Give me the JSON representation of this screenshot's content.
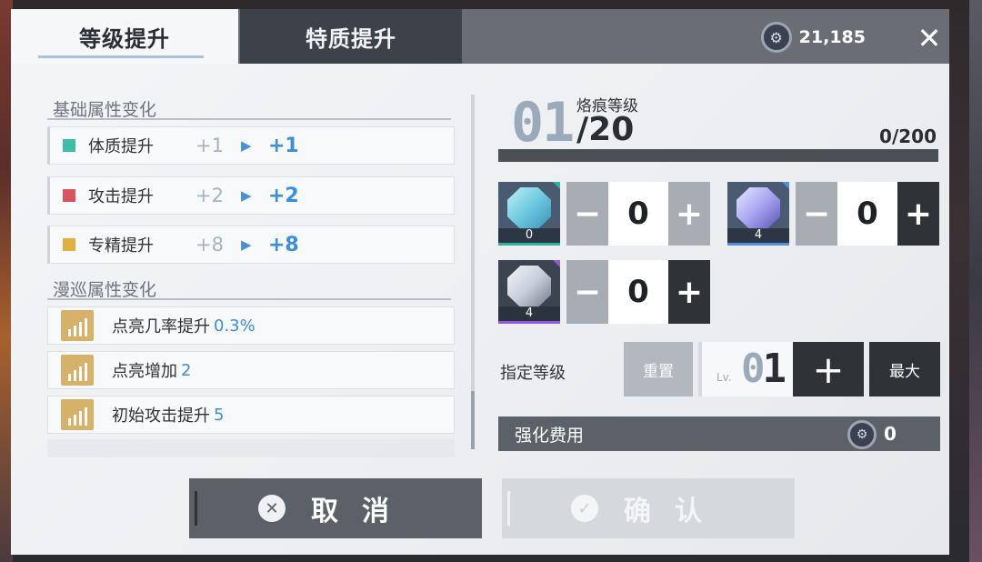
{
  "tabs": {
    "level_up": "等级提升",
    "trait_up": "特质提升"
  },
  "currency": {
    "amount": "21,185",
    "icon": "gear-coin-icon"
  },
  "basic": {
    "title": "基础属性变化",
    "rows": [
      {
        "label": "体质提升",
        "old": "+1",
        "new": "+1",
        "color": "#3dbca6"
      },
      {
        "label": "攻击提升",
        "old": "+2",
        "new": "+2",
        "color": "#d9545c"
      },
      {
        "label": "专精提升",
        "old": "+8",
        "new": "+8",
        "color": "#e0b142"
      }
    ]
  },
  "patrol": {
    "title": "漫巡属性变化",
    "rows": [
      {
        "label": "点亮几率提升",
        "value": "0.3%"
      },
      {
        "label": "点亮增加",
        "value": "2"
      },
      {
        "label": "初始攻击提升",
        "value": "5"
      }
    ]
  },
  "level": {
    "current": "01",
    "name": "烙痕等级",
    "max": "/20",
    "progress": "0/200",
    "progress_fraction": 0
  },
  "materials": [
    {
      "count": "0",
      "qty": "0",
      "rarity_color": "#2fb39a",
      "crystal": "#7fd4e6"
    },
    {
      "count": "4",
      "qty": "0",
      "rarity_color": "#4f8ee0",
      "crystal": "#a8a6f0"
    },
    {
      "count": "4",
      "qty": "0",
      "rarity_color": "#8d5ae0",
      "crystal": "#c9d0dc"
    }
  ],
  "assign": {
    "label": "指定等级",
    "reset": "重置",
    "lv_tag": "Lv.",
    "lv_zero": "0",
    "lv_one": "1",
    "max": "最大"
  },
  "cost": {
    "label": "强化费用",
    "value": "0"
  },
  "buttons": {
    "cancel": "取消",
    "confirm": "确认"
  }
}
